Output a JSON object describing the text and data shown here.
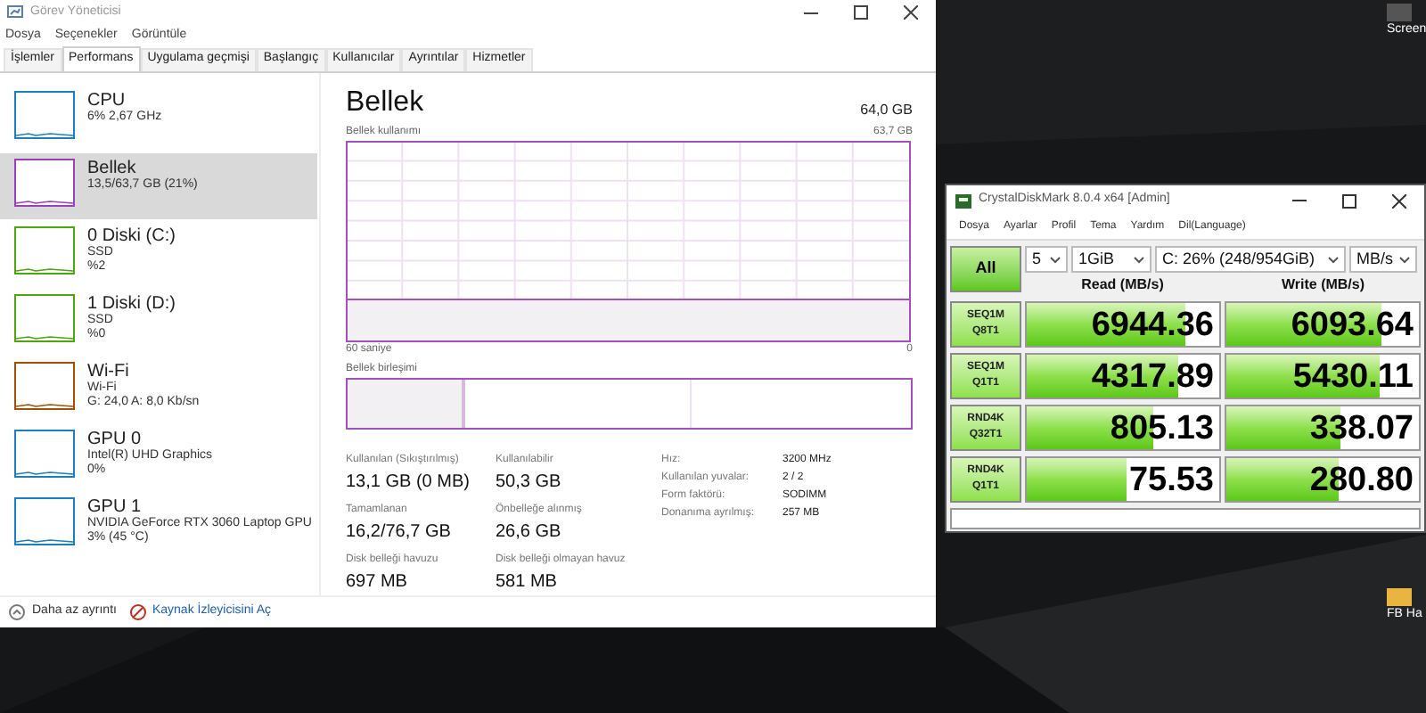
{
  "desktop": {
    "icons": [
      {
        "label": "Screen"
      },
      {
        "label": "FB Ha"
      }
    ]
  },
  "task_manager": {
    "title": "Görev Yöneticisi",
    "menu": [
      "Dosya",
      "Seçenekler",
      "Görüntüle"
    ],
    "tabs": [
      {
        "label": "İşlemler",
        "selected": false
      },
      {
        "label": "Performans",
        "selected": true
      },
      {
        "label": "Uygulama geçmişi",
        "selected": false
      },
      {
        "label": "Başlangıç",
        "selected": false
      },
      {
        "label": "Kullanıcılar",
        "selected": false
      },
      {
        "label": "Ayrıntılar",
        "selected": false
      },
      {
        "label": "Hizmetler",
        "selected": false
      }
    ],
    "sidebar": [
      {
        "name": "CPU",
        "line1": "6% 2,67 GHz",
        "selected": false,
        "color": "#1b7fc4"
      },
      {
        "name": "Bellek",
        "line1": "13,5/63,7 GB (21%)",
        "selected": true,
        "color": "#9b3fbf"
      },
      {
        "name": "0 Diski (C:)",
        "line1": "SSD",
        "line2": "%2",
        "selected": false,
        "color": "#4da60c"
      },
      {
        "name": "1 Diski (D:)",
        "line1": "SSD",
        "line2": "%0",
        "selected": false,
        "color": "#4da60c"
      },
      {
        "name": "Wi-Fi",
        "line1": "Wi-Fi",
        "line2": "G: 24,0 A: 8,0 Kb/sn",
        "selected": false,
        "color": "#a74f01"
      },
      {
        "name": "GPU 0",
        "line1": "Intel(R) UHD Graphics",
        "line2": "0%",
        "selected": false,
        "color": "#1b7fc4"
      },
      {
        "name": "GPU 1",
        "line1": "NVIDIA GeForce RTX 3060 Laptop GPU",
        "line2": "3% (45 °C)",
        "selected": false,
        "color": "#1b7fc4"
      }
    ],
    "memory": {
      "title": "Bellek",
      "total": "64,0 GB",
      "usage_label": "Bellek kullanımı",
      "usage_max": "63,7 GB",
      "time_label": "60 saniye",
      "usage_min": "0",
      "composition_label": "Bellek birleşimi",
      "composition": {
        "level": 0.21
      },
      "stats": [
        {
          "label": "Kullanılan (Sıkıştırılmış)",
          "value": "13,1 GB (0 MB)"
        },
        {
          "label": "Kullanılabilir",
          "value": "50,3 GB"
        },
        {
          "label": "Tamamlanan",
          "value": "16,2/76,7 GB"
        },
        {
          "label": "Önbelleğe alınmış",
          "value": "26,6 GB"
        },
        {
          "label": "Disk belleği havuzu",
          "value": "697 MB"
        },
        {
          "label": "Disk belleği olmayan havuz",
          "value": "581 MB"
        }
      ],
      "specs": [
        {
          "label": "Hız:",
          "value": "3200 MHz"
        },
        {
          "label": "Kullanılan yuvalar:",
          "value": "2 / 2"
        },
        {
          "label": "Form faktörü:",
          "value": "SODIMM"
        },
        {
          "label": "Donanıma ayrılmış:",
          "value": "257 MB"
        }
      ]
    },
    "footer": {
      "less_details": "Daha az ayrıntı",
      "resource_monitor": "Kaynak İzleyicisini Aç"
    }
  },
  "diskmark": {
    "title": "CrystalDiskMark 8.0.4 x64 [Admin]",
    "menu": [
      "Dosya",
      "Ayarlar",
      "Profil",
      "Tema",
      "Yardım",
      "Dil(Language)"
    ],
    "all_button": "All",
    "count": "5",
    "size": "1GiB",
    "drive": "C: 26% (248/954GiB)",
    "unit": "MB/s",
    "read_header": "Read (MB/s)",
    "write_header": "Write (MB/s)",
    "rows": [
      {
        "test": "SEQ1M",
        "params": "Q8T1",
        "read": {
          "value": "6944.36",
          "level": 0.82
        },
        "write": {
          "value": "6093.64",
          "level": 0.81
        }
      },
      {
        "test": "SEQ1M",
        "params": "Q1T1",
        "read": {
          "value": "4317.89",
          "level": 0.79
        },
        "write": {
          "value": "5430.11",
          "level": 0.8
        }
      },
      {
        "test": "RND4K",
        "params": "Q32T1",
        "read": {
          "value": "805.13",
          "level": 0.66
        },
        "write": {
          "value": "338.07",
          "level": 0.59
        }
      },
      {
        "test": "RND4K",
        "params": "Q1T1",
        "read": {
          "value": "75.53",
          "level": 0.52
        },
        "write": {
          "value": "280.80",
          "level": 0.58
        }
      }
    ]
  }
}
